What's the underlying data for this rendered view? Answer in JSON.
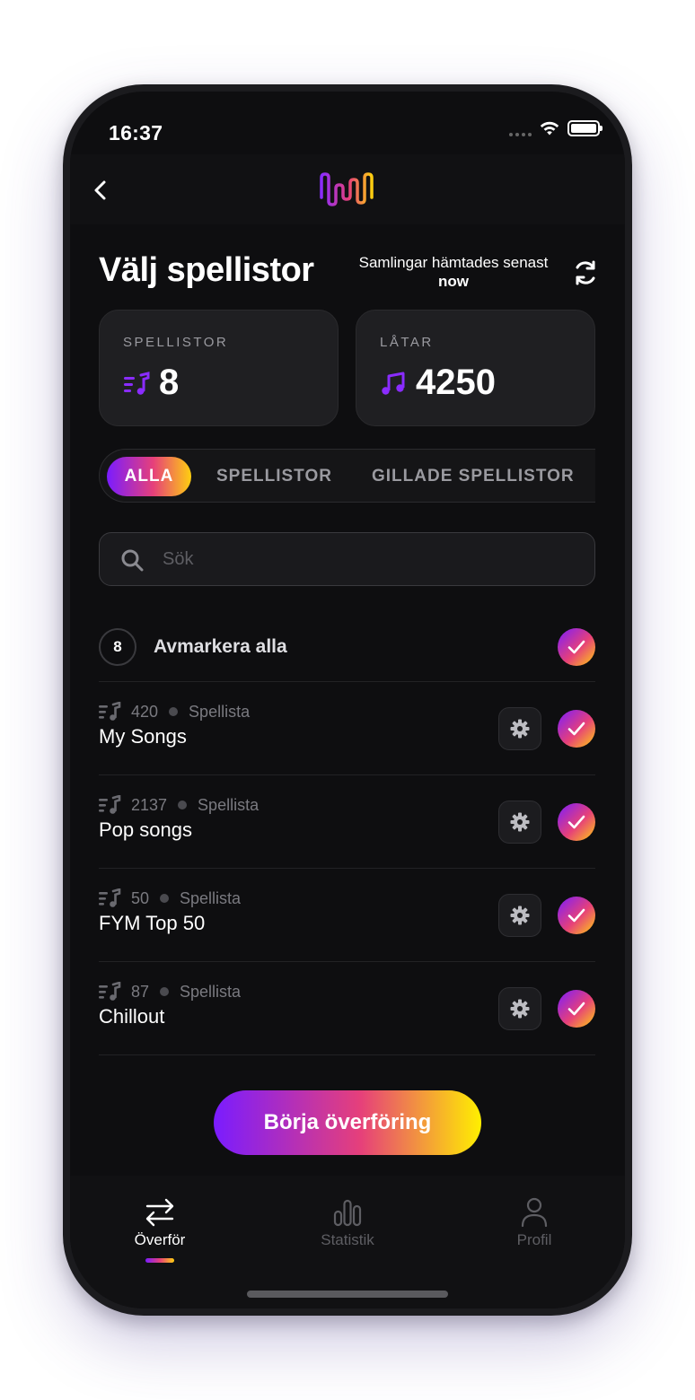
{
  "status_bar": {
    "time": "16:37"
  },
  "header": {
    "back_icon": "chevron-left-icon",
    "logo": "waveform-logo"
  },
  "page": {
    "title": "Välj spellistor",
    "refresh_label": "Samlingar hämtades senast",
    "refresh_value": "now"
  },
  "stats": {
    "playlists_label": "SPELLISTOR",
    "playlists_value": "8",
    "tracks_label": "LÅTAR",
    "tracks_value": "4250"
  },
  "tabs": [
    {
      "label": "ALLA",
      "active": true
    },
    {
      "label": "SPELLISTOR",
      "active": false
    },
    {
      "label": "GILLADE SPELLISTOR",
      "active": false
    }
  ],
  "search": {
    "placeholder": "Sök",
    "value": ""
  },
  "select_all": {
    "count": "8",
    "label": "Avmarkera alla",
    "checked": true
  },
  "playlists": [
    {
      "count": "420",
      "type": "Spellista",
      "name": "My Songs",
      "checked": true
    },
    {
      "count": "2137",
      "type": "Spellista",
      "name": "Pop songs",
      "checked": true
    },
    {
      "count": "50",
      "type": "Spellista",
      "name": "FYM Top 50",
      "checked": true
    },
    {
      "count": "87",
      "type": "Spellista",
      "name": "Chillout",
      "checked": true
    }
  ],
  "cta": {
    "label": "Börja överföring"
  },
  "bottom_nav": [
    {
      "label": "Överför",
      "icon": "transfer-arrows-icon",
      "active": true
    },
    {
      "label": "Statistik",
      "icon": "bar-chart-icon",
      "active": false
    },
    {
      "label": "Profil",
      "icon": "person-icon",
      "active": false
    }
  ],
  "colors": {
    "background": "#0e0e10",
    "gradient_start": "#7a1cff",
    "gradient_mid": "#e6407a",
    "gradient_end": "#ffcf10",
    "accent_purple": "#8a2cff"
  }
}
